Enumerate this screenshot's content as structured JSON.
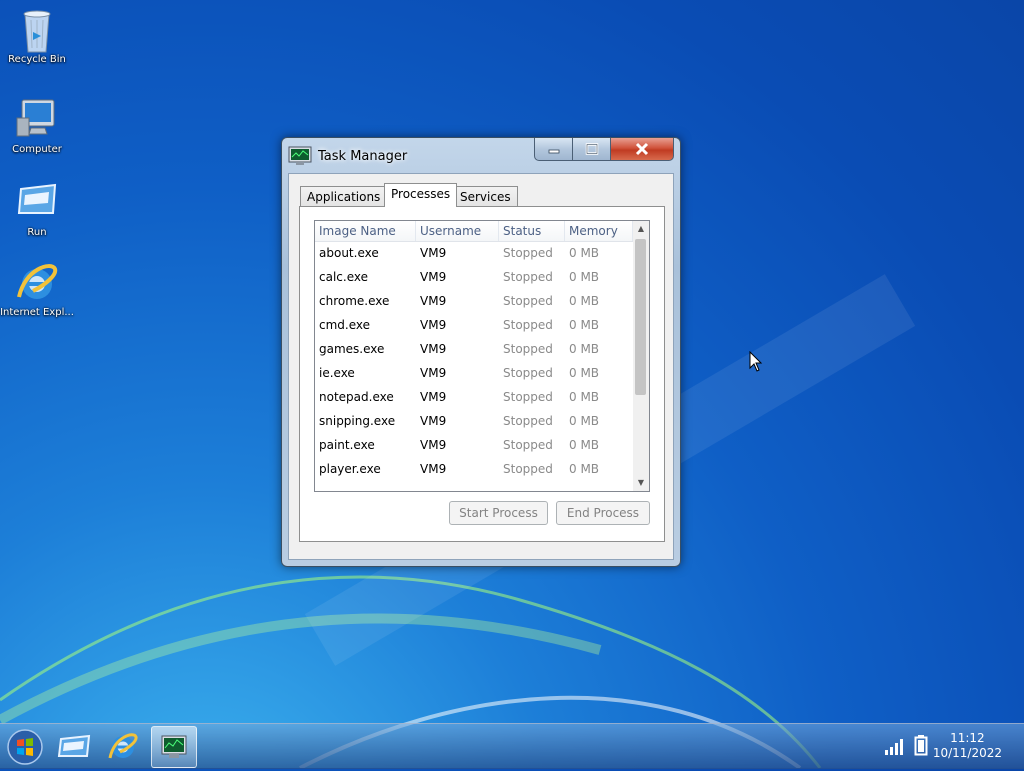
{
  "desktop": {
    "icons": [
      {
        "label": "Recycle Bin",
        "icon": "recycle-bin-icon"
      },
      {
        "label": "Computer",
        "icon": "computer-icon"
      },
      {
        "label": "Run",
        "icon": "run-icon"
      },
      {
        "label": "Internet Expl...",
        "icon": "internet-explorer-icon"
      }
    ]
  },
  "window": {
    "title": "Task Manager",
    "tabs": [
      {
        "label": "Applications",
        "active": false
      },
      {
        "label": "Processes",
        "active": true
      },
      {
        "label": "Services",
        "active": false
      }
    ],
    "columns": [
      "Image Name",
      "Username",
      "Status",
      "Memory"
    ],
    "rows": [
      [
        "about.exe",
        "VM9",
        "Stopped",
        "0 MB"
      ],
      [
        "calc.exe",
        "VM9",
        "Stopped",
        "0 MB"
      ],
      [
        "chrome.exe",
        "VM9",
        "Stopped",
        "0 MB"
      ],
      [
        "cmd.exe",
        "VM9",
        "Stopped",
        "0 MB"
      ],
      [
        "games.exe",
        "VM9",
        "Stopped",
        "0 MB"
      ],
      [
        "ie.exe",
        "VM9",
        "Stopped",
        "0 MB"
      ],
      [
        "notepad.exe",
        "VM9",
        "Stopped",
        "0 MB"
      ],
      [
        "snipping.exe",
        "VM9",
        "Stopped",
        "0 MB"
      ],
      [
        "paint.exe",
        "VM9",
        "Stopped",
        "0 MB"
      ],
      [
        "player.exe",
        "VM9",
        "Stopped",
        "0 MB"
      ]
    ],
    "buttons": {
      "start_process": "Start Process",
      "end_process": "End Process"
    }
  },
  "taskbar": {
    "clock_time": "11:12",
    "clock_date": "10/11/2022"
  },
  "colors": {
    "desktop_bg": "#0f5fc6",
    "close_button": "#c03b22"
  }
}
